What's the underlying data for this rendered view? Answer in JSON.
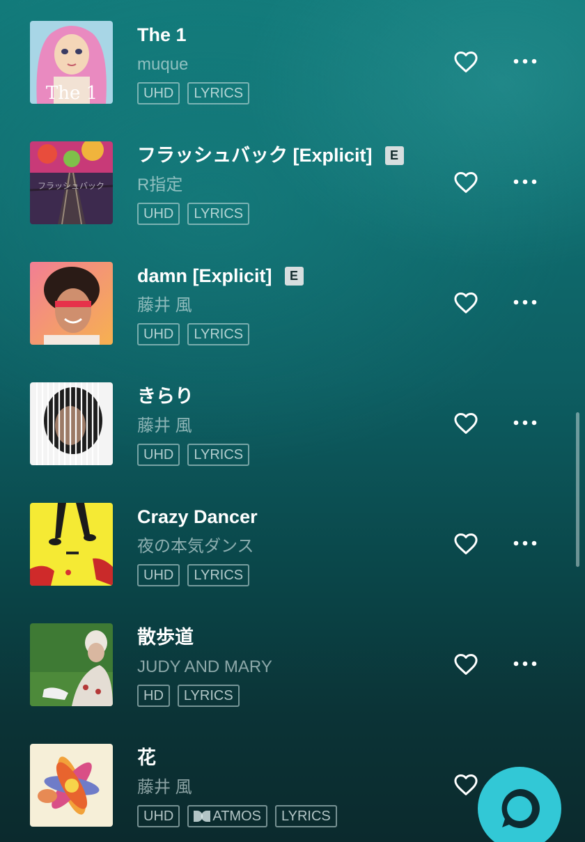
{
  "tracks": [
    {
      "title": "The 1",
      "artist": "muque",
      "explicit": "",
      "badges": [
        "UHD",
        "LYRICS"
      ],
      "art_text": "The 1"
    },
    {
      "title": "フラッシュバック [Explicit]",
      "artist": "R指定",
      "explicit": "E",
      "badges": [
        "UHD",
        "LYRICS"
      ],
      "art_text": "フラッシュバック"
    },
    {
      "title": "damn [Explicit]",
      "artist": "藤井 風",
      "explicit": "E",
      "badges": [
        "UHD",
        "LYRICS"
      ],
      "art_text": ""
    },
    {
      "title": "きらり",
      "artist": "藤井 風",
      "explicit": "",
      "badges": [
        "UHD",
        "LYRICS"
      ],
      "art_text": ""
    },
    {
      "title": "Crazy Dancer",
      "artist": "夜の本気ダンス",
      "explicit": "",
      "badges": [
        "UHD",
        "LYRICS"
      ],
      "art_text": ""
    },
    {
      "title": "散歩道",
      "artist": "JUDY AND MARY",
      "explicit": "",
      "badges": [
        "HD",
        "LYRICS"
      ],
      "art_text": ""
    },
    {
      "title": "花",
      "artist": "藤井 風",
      "explicit": "",
      "badges": [
        "UHD",
        "ATMOS",
        "LYRICS"
      ],
      "art_text": ""
    }
  ],
  "icons": {
    "favorite": "heart-outline-icon",
    "more": "more-horizontal-icon",
    "assistant": "alexa-icon",
    "atmos_logo": "dolby-icon"
  },
  "colors": {
    "accent": "#32c8d6",
    "explicit_badge_bg": "#d7dedf"
  }
}
